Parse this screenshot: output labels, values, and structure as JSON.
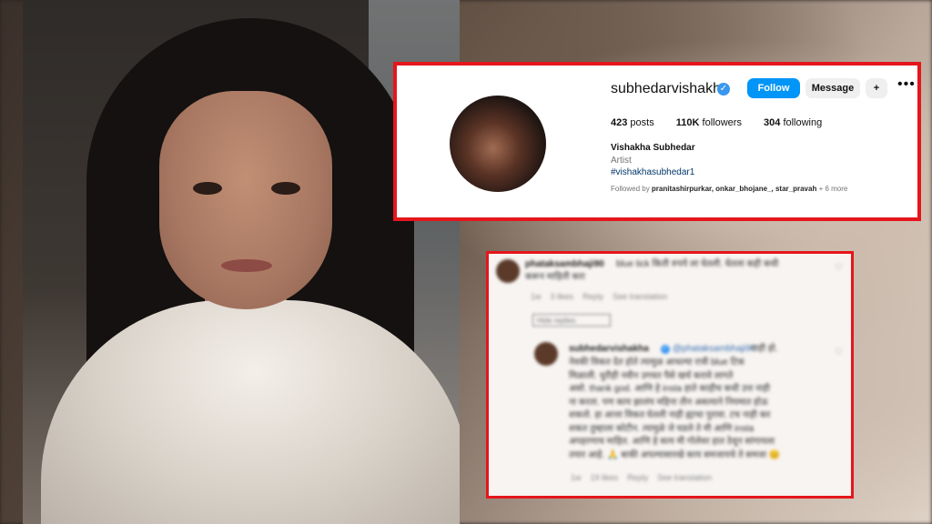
{
  "profile": {
    "username": "subhedarvishakha",
    "verified_badge": "✓",
    "follow_label": "Follow",
    "message_label": "Message",
    "add_user_glyph": "+",
    "more_glyph": "•••",
    "stats": [
      {
        "value": "423",
        "label": "posts"
      },
      {
        "value": "110K",
        "label": "followers"
      },
      {
        "value": "304",
        "label": "following"
      }
    ],
    "display_name": "Vishakha Subhedar",
    "category": "Artist",
    "hashtag": "#vishakhasubhedar1",
    "followed_by_prefix": "Followed by",
    "followed_by_names": "pranitashirpurkar, onkar_bhojane_, star_pravah",
    "followed_by_suffix": "+ 6 more"
  },
  "comment": {
    "user": "phataksambhaji90",
    "text_lines": [
      "blue tick किती रुपये ला घेतली. घेतला कही कधी",
      "करून माहिती करा"
    ],
    "meta": [
      "1w",
      "3 likes",
      "Reply",
      "See translation"
    ],
    "hide_replies": "Hide replies"
  },
  "reply": {
    "user": "subhedarvishakha",
    "mention": "@phataksambhaji90",
    "text_lines": [
      "नाही हो.",
      "नेवकी विकत देत होते त्यामुळ आधल्या रात्री blue टिक",
      "मिळाली. धुरीही नवीन उगवत पैसे खर्च करावे लागते",
      "असो. thank god. आणि हे insta हाते काहीच कधी उत्त नाही",
      "ना करता. पण काय झालंय महिना तीन असत्याने नियमात होऊ",
      "शकतो. हा आत्ता विकत घेतली नाही ह्याचा पुरावा. टच नाही कर",
      "शकत तुम्हाला कोटीन. त्यामुळे जे घडले ते मी आणि insta",
      "अपहरणाच माहित. आणि हे सत्य मी गोलेवर हात ठेवून सांगायला",
      "तयार आहे. 🙏 बाकी अपल्यासारखे काय समजायचे ते समजा 😊"
    ],
    "meta": [
      "1w",
      "19 likes",
      "Reply",
      "See translation"
    ]
  },
  "icons": {
    "heart": "♡"
  },
  "colors": {
    "highlight_border": "#e5161b",
    "follow_button": "#0095f6",
    "verified_badge": "#3897f0"
  }
}
